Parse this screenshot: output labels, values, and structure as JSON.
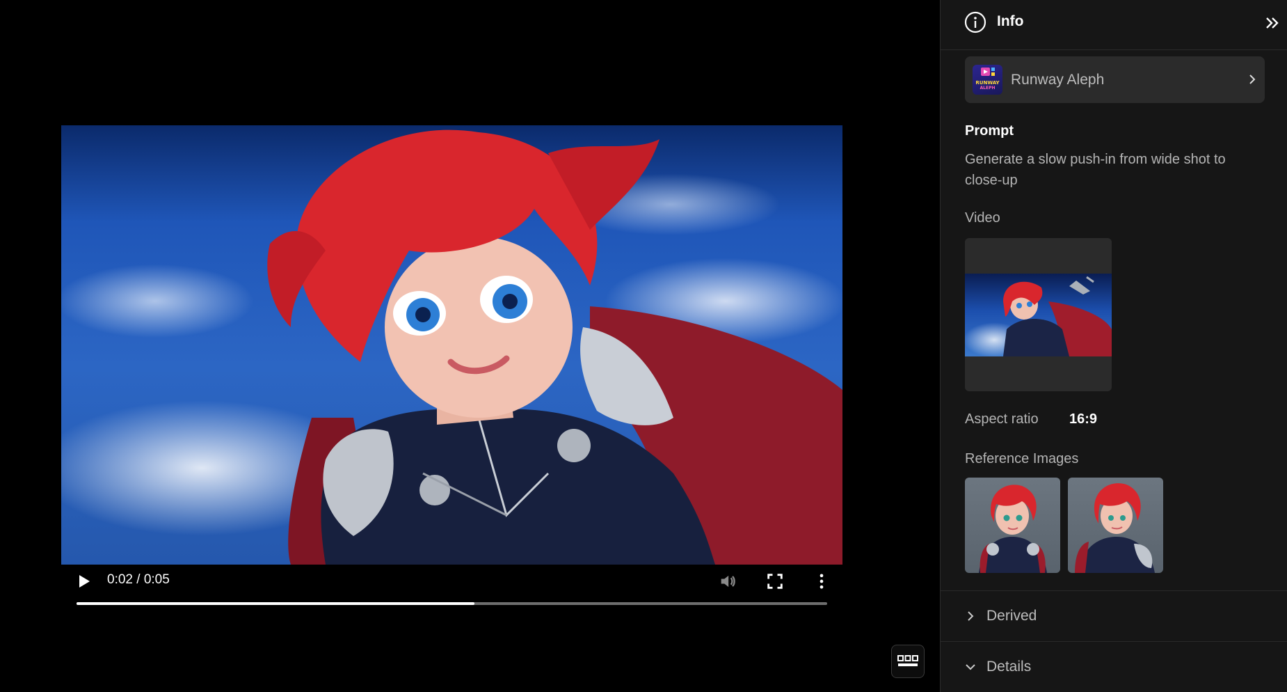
{
  "player": {
    "time": "0:02 / 0:05",
    "progress": 0.53
  },
  "panel": {
    "title": "Info",
    "model": {
      "name": "Runway Aleph",
      "logo_line1": "RUNWAY",
      "logo_line2": "ALEPH"
    },
    "prompt": {
      "heading": "Prompt",
      "text": "Generate a slow push-in from wide shot to close-up"
    },
    "video_label": "Video",
    "aspect_ratio": {
      "label": "Aspect ratio",
      "value": "16:9"
    },
    "reference_images_label": "Reference Images",
    "sections": {
      "derived": "Derived",
      "details": "Details"
    }
  },
  "colors": {
    "panel_bg": "#161616",
    "card_bg": "#2b2b2b",
    "muted_text": "#b5b5b5"
  },
  "icons": [
    "play-icon",
    "volume-icon",
    "fullscreen-icon",
    "more-vertical-icon",
    "info-icon",
    "collapse-double-chevron-icon",
    "chevron-right-icon",
    "chevron-down-icon",
    "dots-grid-icon"
  ]
}
